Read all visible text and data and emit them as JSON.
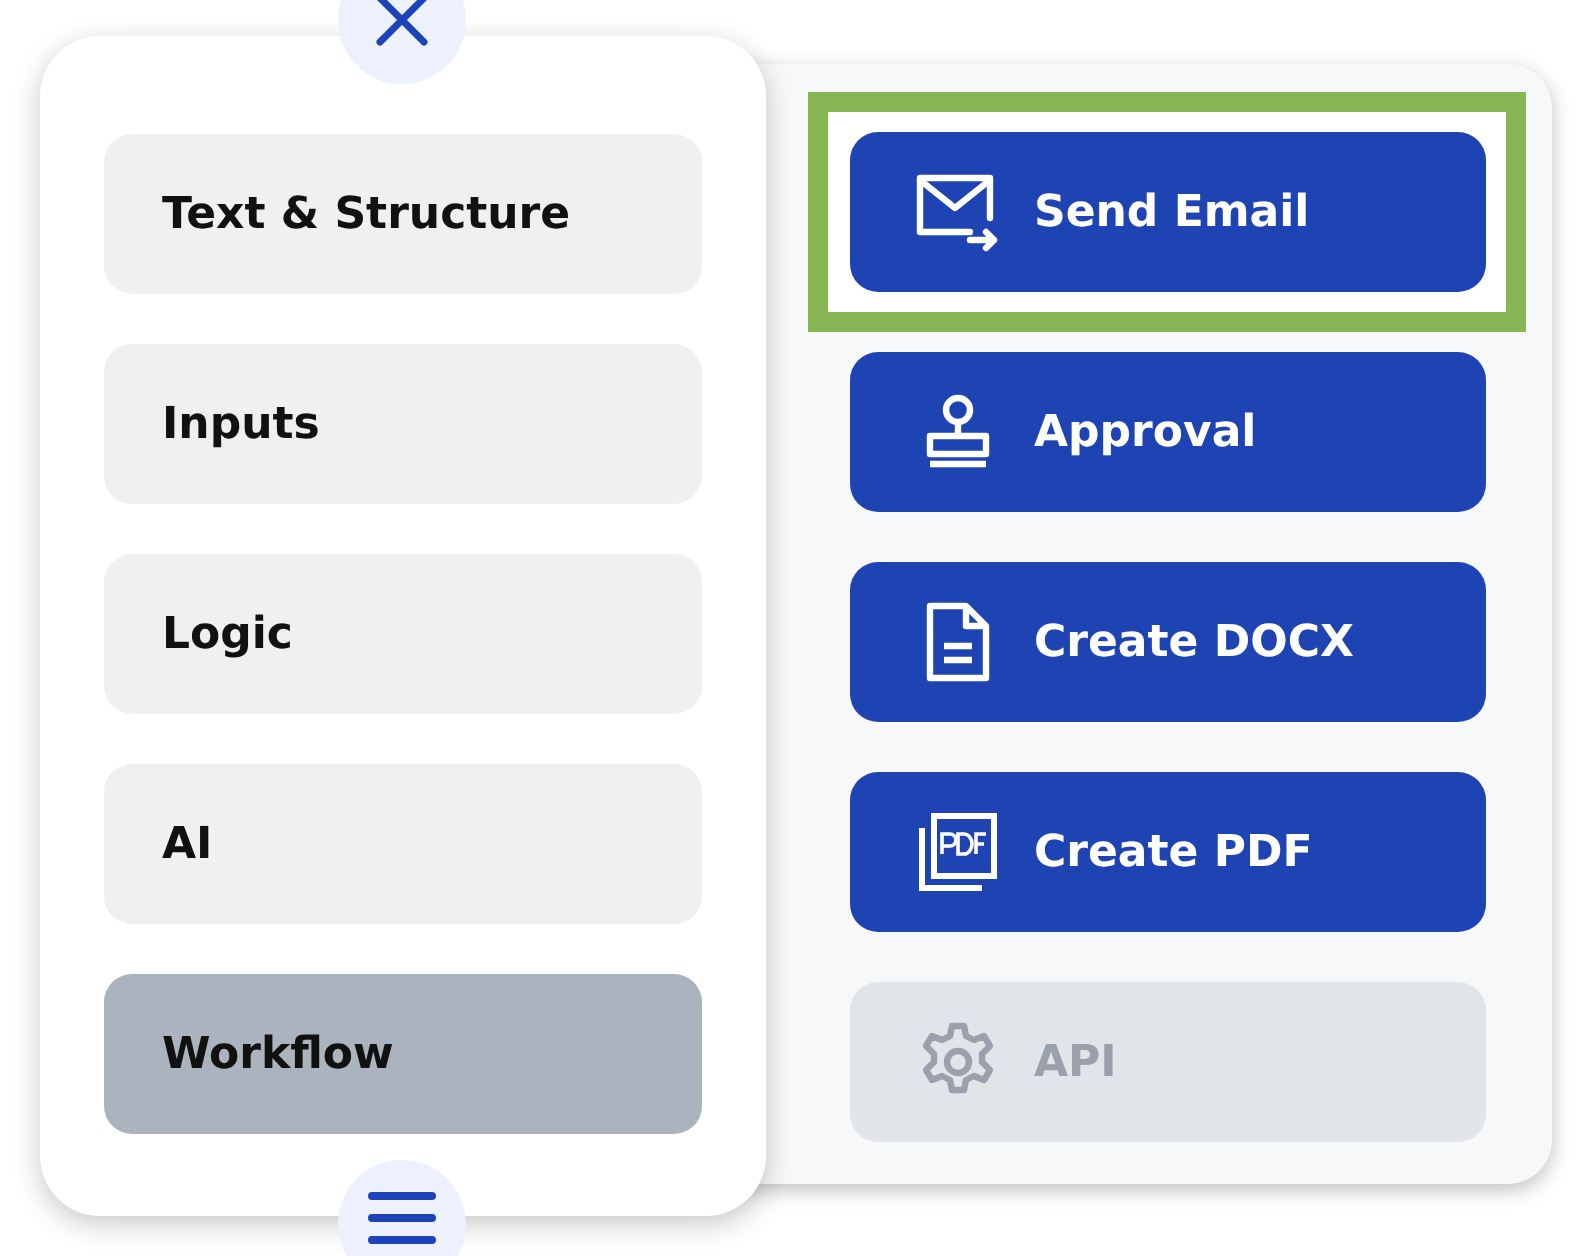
{
  "categories": [
    {
      "label": "Text & Structure",
      "selected": false
    },
    {
      "label": "Inputs",
      "selected": false
    },
    {
      "label": "Logic",
      "selected": false
    },
    {
      "label": "AI",
      "selected": false
    },
    {
      "label": "Workflow",
      "selected": true
    }
  ],
  "actions": [
    {
      "label": "Send Email",
      "kind": "email",
      "disabled": false,
      "highlighted": true
    },
    {
      "label": "Approval",
      "kind": "stamp",
      "disabled": false,
      "highlighted": false
    },
    {
      "label": "Create DOCX",
      "kind": "doc",
      "disabled": false,
      "highlighted": false
    },
    {
      "label": "Create PDF",
      "kind": "pdf",
      "disabled": false,
      "highlighted": false
    },
    {
      "label": "API",
      "kind": "gear",
      "disabled": true,
      "highlighted": false
    }
  ]
}
